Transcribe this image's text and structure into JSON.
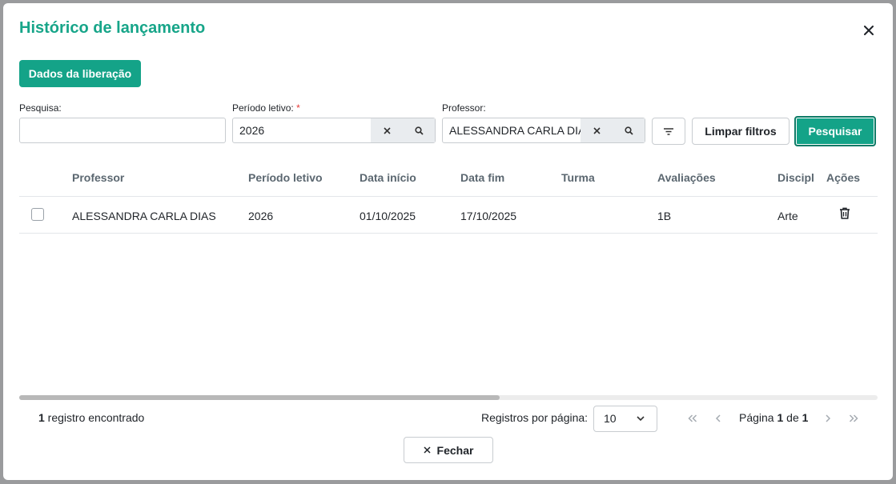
{
  "modal": {
    "title": "Histórico de lançamento",
    "close_icon": "close-icon"
  },
  "toolbar": {
    "release_data_label": "Dados da liberação"
  },
  "filters": {
    "search": {
      "label": "Pesquisa:",
      "value": ""
    },
    "period": {
      "label": "Período letivo:",
      "required_mark": "*",
      "value": "2026"
    },
    "teacher": {
      "label": "Professor:",
      "value": "ALESSANDRA CARLA DIAS"
    },
    "clear_label": "Limpar filtros",
    "search_label": "Pesquisar"
  },
  "table": {
    "columns": [
      "Professor",
      "Período letivo",
      "Data início",
      "Data fim",
      "Turma",
      "Avaliações",
      "Discipli",
      "Ações"
    ],
    "rows": [
      {
        "professor": "ALESSANDRA CARLA DIAS",
        "periodo": "2026",
        "data_inicio": "01/10/2025",
        "data_fim": "17/10/2025",
        "turma": "",
        "avaliacoes": "1B",
        "disciplina": "Arte"
      }
    ]
  },
  "footer": {
    "records_count": "1",
    "records_label": " registro encontrado",
    "per_page_label": "Registros por página:",
    "per_page_value": "10",
    "page_prefix": "Página ",
    "page_current": "1",
    "page_of": " de ",
    "page_total": "1",
    "close_label": "Fechar"
  },
  "colors": {
    "accent": "#14a388",
    "title": "#17a589"
  }
}
